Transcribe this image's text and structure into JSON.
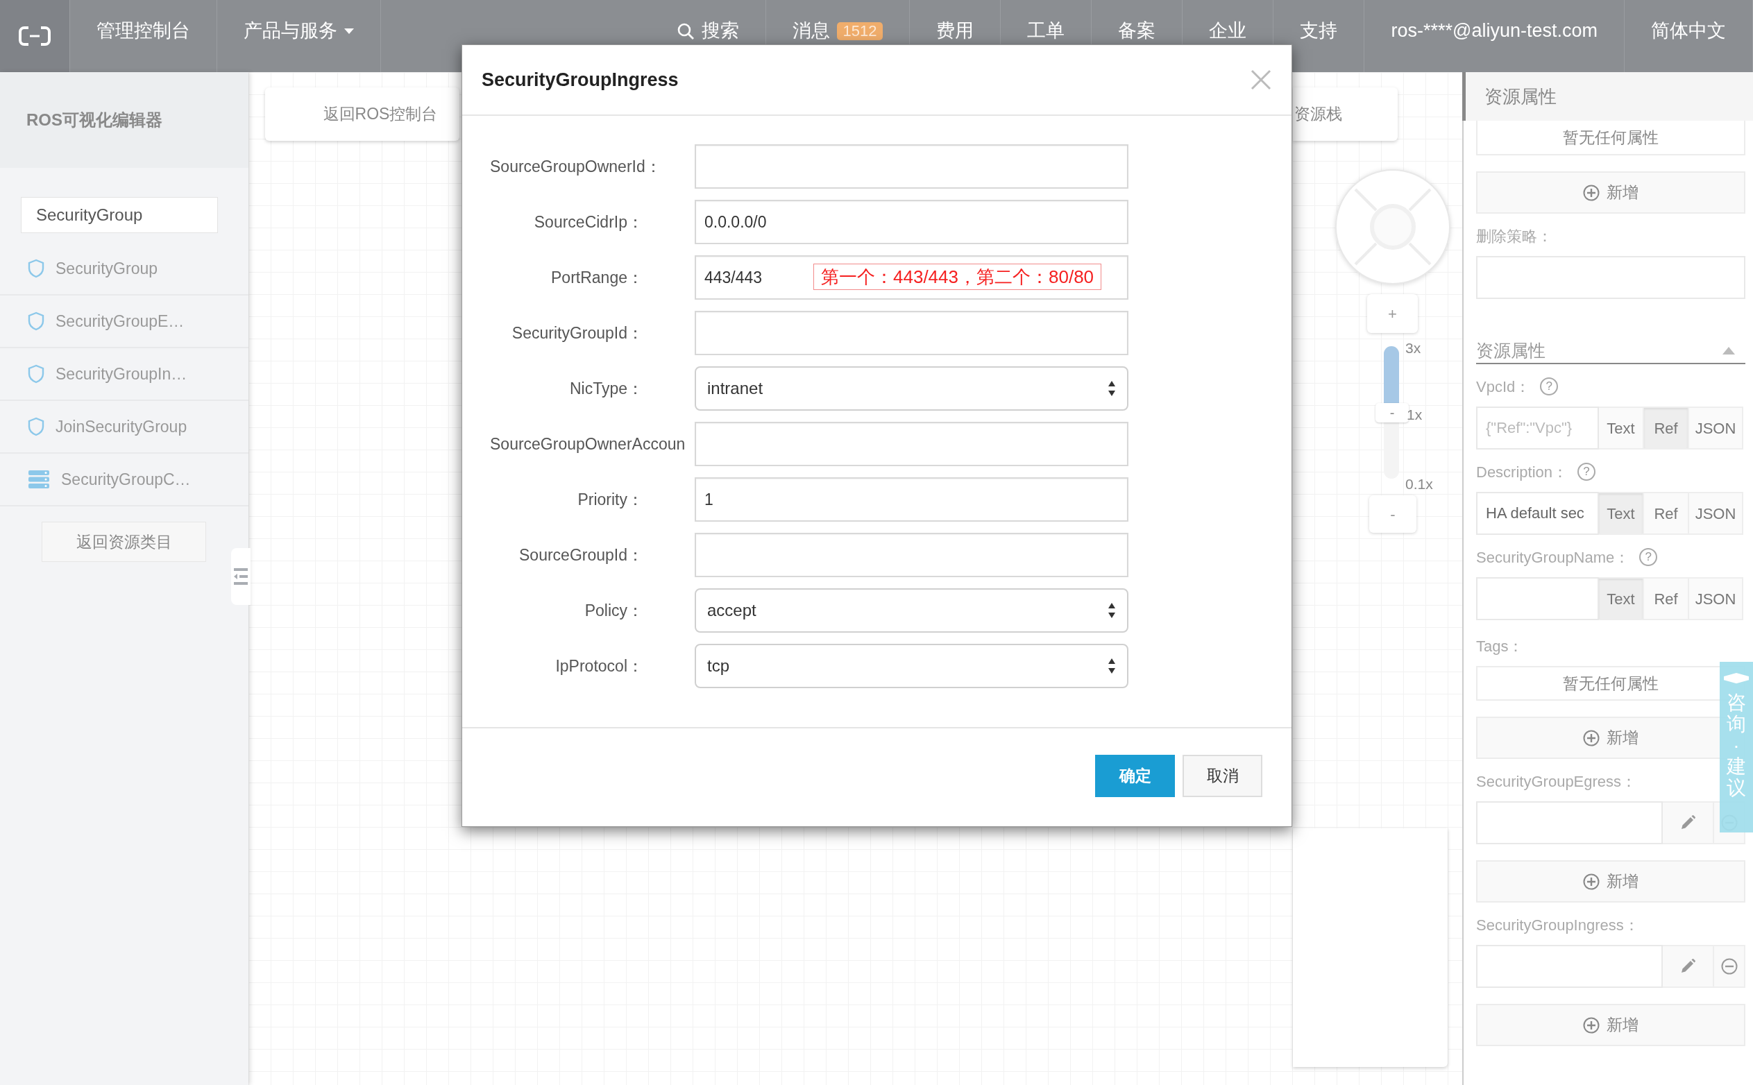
{
  "top_nav": {
    "items": [
      {
        "label": "管理控制台",
        "kind": "text"
      },
      {
        "label": "产品与服务",
        "kind": "dropdown"
      },
      {
        "label": "搜索",
        "kind": "search"
      },
      {
        "label": "消息",
        "kind": "badge",
        "badge": "1512"
      },
      {
        "label": "费用",
        "kind": "text"
      },
      {
        "label": "工单",
        "kind": "text"
      },
      {
        "label": "备案",
        "kind": "text"
      },
      {
        "label": "企业",
        "kind": "text"
      },
      {
        "label": "支持",
        "kind": "text"
      },
      {
        "label": "ros-****@aliyun-test.com",
        "kind": "text"
      },
      {
        "label": "简体中文",
        "kind": "text"
      }
    ]
  },
  "sidebar": {
    "title": "ROS可视化编辑器",
    "search": {
      "value": "SecurityGroup"
    },
    "items": [
      {
        "label": "SecurityGroup",
        "kind": "shield"
      },
      {
        "label": "SecurityGroupE…",
        "kind": "shield"
      },
      {
        "label": "SecurityGroupIn…",
        "kind": "shield"
      },
      {
        "label": "JoinSecurityGroup",
        "kind": "shield"
      },
      {
        "label": "SecurityGroupC…",
        "kind": "server"
      }
    ],
    "back_button": "返回资源类目"
  },
  "canvas": {
    "cards": [
      "返回ROS控制台",
      "资源栈"
    ],
    "zoom": {
      "plus": "+",
      "minus": "-",
      "handle": "-",
      "level": 0.5,
      "labels": [
        "3x",
        "1x",
        "0.1x"
      ]
    }
  },
  "dialog": {
    "title": "SecurityGroupIngress",
    "fields": [
      {
        "label": "SourceGroupOwnerId：",
        "kind": "text"
      },
      {
        "label": "SourceCidrIp：",
        "kind": "text",
        "value": "0.0.0.0/0"
      },
      {
        "label": "PortRange：",
        "kind": "text",
        "value": "443/443",
        "annotation": "第一个：443/443，第二个：80/80"
      },
      {
        "label": "SecurityGroupId：",
        "kind": "text"
      },
      {
        "label": "NicType：",
        "kind": "select",
        "value": "intranet"
      },
      {
        "label": "SourceGroupOwnerAccoun",
        "kind": "text"
      },
      {
        "label": "Priority：",
        "kind": "text",
        "value": "1"
      },
      {
        "label": "SourceGroupId：",
        "kind": "text"
      },
      {
        "label": "Policy：",
        "kind": "select",
        "value": "accept"
      },
      {
        "label": "IpProtocol：",
        "kind": "select",
        "value": "tcp"
      }
    ],
    "buttons": [
      {
        "label": "确定",
        "kind": "primary"
      },
      {
        "label": "取消",
        "kind": "default"
      }
    ]
  },
  "right_panel": {
    "title": "资源属性",
    "items": [
      {
        "kind": "note",
        "text": "暂无任何属性"
      },
      {
        "kind": "add",
        "label": "新增"
      },
      {
        "kind": "field",
        "label": "删除策略："
      },
      {
        "kind": "section",
        "title": "资源属性",
        "expanded": true
      },
      {
        "kind": "prop",
        "label": "VpcId：",
        "help": "?",
        "placeholder": "{\"Ref\":\"Vpc\"}",
        "modes": [
          {
            "label": "Text",
            "selected": false
          },
          {
            "label": "Ref",
            "selected": true
          },
          {
            "label": "JSON",
            "selected": false
          }
        ]
      },
      {
        "kind": "prop",
        "label": "Description：",
        "help": "?",
        "value": "HA default sec",
        "modes": [
          {
            "label": "Text",
            "selected": true
          },
          {
            "label": "Ref",
            "selected": false
          },
          {
            "label": "JSON",
            "selected": false
          }
        ]
      },
      {
        "kind": "prop",
        "label": "SecurityGroupName：",
        "help": "?",
        "modes": [
          {
            "label": "Text",
            "selected": true
          },
          {
            "label": "Ref",
            "selected": false
          },
          {
            "label": "JSON",
            "selected": false
          }
        ]
      },
      {
        "kind": "label",
        "text": "Tags："
      },
      {
        "kind": "note",
        "text": "暂无任何属性"
      },
      {
        "kind": "add",
        "label": "新增"
      },
      {
        "kind": "list",
        "label": "SecurityGroupEgress："
      },
      {
        "kind": "add",
        "label": "新增"
      },
      {
        "kind": "list",
        "label": "SecurityGroupIngress："
      },
      {
        "kind": "add",
        "label": "新增"
      }
    ]
  },
  "feedback": {
    "label": "咨询·建议"
  }
}
